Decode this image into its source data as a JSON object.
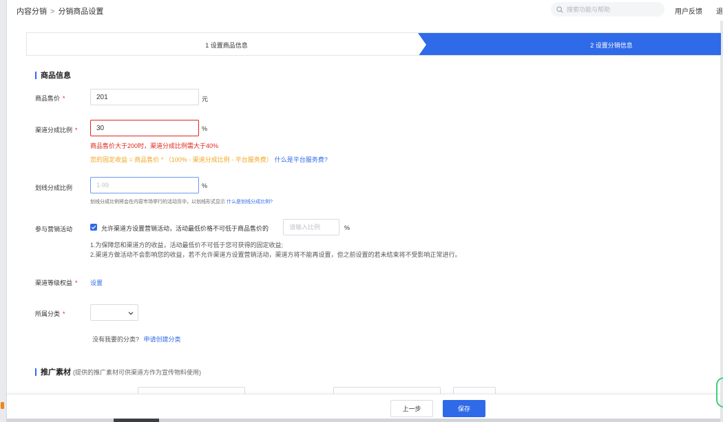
{
  "topbar": {
    "breadcrumb_parent": "内容分销",
    "breadcrumb_sep": ">",
    "breadcrumb_current": "分销商品设置",
    "search_placeholder": "搜索功能与帮助",
    "feedback_label": "用户反馈",
    "exit_label": "退出"
  },
  "steps": [
    {
      "label": "1 设置商品信息",
      "active": false
    },
    {
      "label": "2 设置分销信息",
      "active": true
    }
  ],
  "product_section": {
    "title": "商品信息"
  },
  "price": {
    "label": "商品售价",
    "required_mark": "*",
    "value": "201",
    "unit": "元"
  },
  "channel_ratio": {
    "label": "渠道分成比例",
    "required_mark": "*",
    "value": "30",
    "unit": "%",
    "error": "商品售价大于200时，渠道分成比例需大于40%",
    "formula": "您的固定收益 = 商品售价 * （100% - 渠道分成比例 - 平台服务费）",
    "formula_link": "什么是平台服务费?"
  },
  "strike_ratio": {
    "label": "划线分成比例",
    "placeholder": "1-99",
    "unit": "%",
    "hint": "划线分成比例将会在内容市场举行的活动页中，以划线形式显示 ",
    "hint_link": "什么是划线分成比例?"
  },
  "marketing": {
    "label": "参与营销活动",
    "checked": true,
    "checkbox_label": "允许渠道方设置营销活动，活动最低价格不可低于商品售价的",
    "ratio_placeholder": "请输入比例",
    "unit": "%",
    "note_1": "1.为保障您和渠道方的收益，活动最低价不可低于您可获得的固定收益;",
    "note_2": "2.渠道方做活动不会影响您的收益，若不允许渠道方设置营销活动，渠道方将不能再设置，但之前设置的若未结束将不受影响正常进行。"
  },
  "channel_level": {
    "label": "渠道等级权益",
    "required_mark": "*",
    "link": "设置"
  },
  "category": {
    "label": "所属分类",
    "required_mark": "*",
    "selected": "",
    "missing_text": "没有我要的分类?",
    "create_link": "申请创建分类"
  },
  "promo_section": {
    "title": "推广素材",
    "subtitle": "(提供的推广素材可供渠道方作为宣传物料使用)"
  },
  "footer": {
    "prev_label": "上一步",
    "save_label": "保存"
  },
  "colors": {
    "primary": "#2f6ae8",
    "error": "#e2231a",
    "warning": "#f0a71e"
  }
}
